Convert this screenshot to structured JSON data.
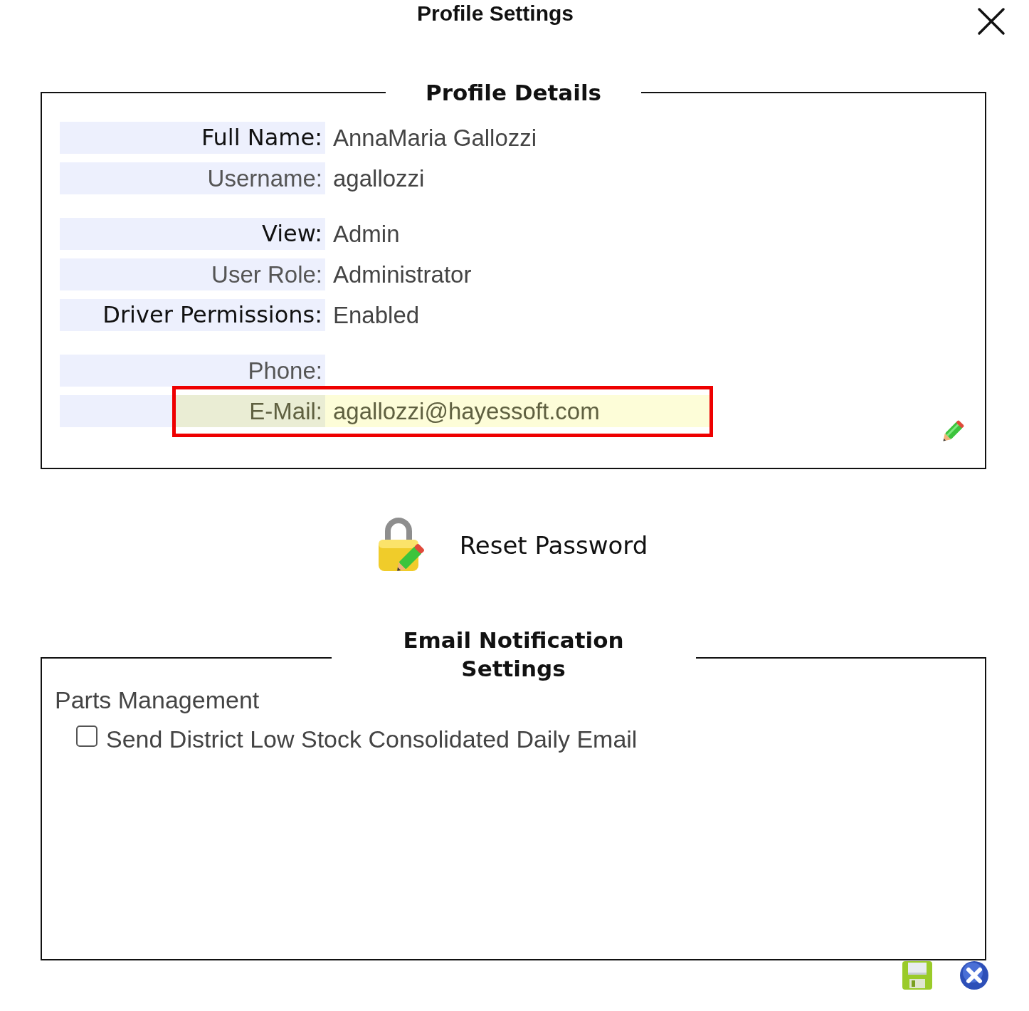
{
  "window": {
    "title": "Profile Settings"
  },
  "profile_details": {
    "legend": "Profile Details",
    "groups": [
      {
        "rows": [
          {
            "label": "Full Name:",
            "value": "AnnaMaria Gallozzi",
            "kind": "strong",
            "highlighted": false
          },
          {
            "label": "Username:",
            "value": "agallozzi",
            "kind": "plain",
            "highlighted": false
          }
        ]
      },
      {
        "rows": [
          {
            "label": "View:",
            "value": "Admin",
            "kind": "strong",
            "highlighted": false
          },
          {
            "label": "User Role:",
            "value": "Administrator",
            "kind": "plain",
            "highlighted": false
          },
          {
            "label": "Driver Permissions:",
            "value": "Enabled",
            "kind": "strong",
            "highlighted": false
          }
        ]
      },
      {
        "rows": [
          {
            "label": "Phone:",
            "kind": "plain",
            "highlighted": false
          },
          {
            "label": "E-Mail:",
            "value": "agallozzi@hayessoft.com",
            "kind": "plain",
            "highlighted": true
          }
        ]
      }
    ]
  },
  "reset_password": {
    "label": "Reset Password"
  },
  "email_notifications": {
    "legend": "Email Notification Settings",
    "sections": [
      {
        "heading": "Parts Management",
        "options": [
          {
            "label": "Send District Low Stock Consolidated Daily Email",
            "checked": false
          }
        ]
      }
    ]
  }
}
